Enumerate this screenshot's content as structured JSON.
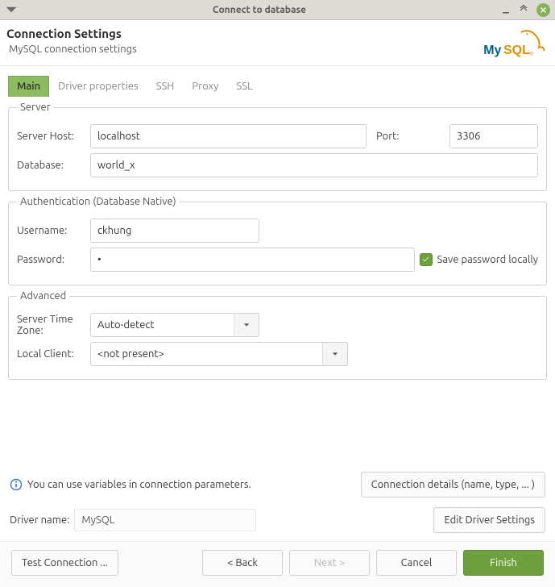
{
  "window": {
    "title": "Connect to database"
  },
  "header": {
    "title": "Connection Settings",
    "subtitle": "MySQL connection settings",
    "logo_text": "MySQL"
  },
  "tabs": [
    {
      "label": "Main",
      "active": true
    },
    {
      "label": "Driver properties",
      "active": false
    },
    {
      "label": "SSH",
      "active": false
    },
    {
      "label": "Proxy",
      "active": false
    },
    {
      "label": "SSL",
      "active": false
    }
  ],
  "server": {
    "legend": "Server",
    "host_label": "Server Host:",
    "host_value": "localhost",
    "port_label": "Port:",
    "port_value": "3306",
    "db_label": "Database:",
    "db_value": "world_x"
  },
  "auth": {
    "legend": "Authentication (Database Native)",
    "user_label": "Username:",
    "user_value": "ckhung",
    "pass_label": "Password:",
    "pass_value": "•",
    "save_label": "Save password locally",
    "save_checked": true
  },
  "advanced": {
    "legend": "Advanced",
    "tz_label": "Server Time Zone:",
    "tz_value": "Auto-detect",
    "client_label": "Local Client:",
    "client_value": "<not present>"
  },
  "info": {
    "text": "You can use variables in connection parameters.",
    "details_btn": "Connection details (name, type, ... )"
  },
  "driver": {
    "label": "Driver name:",
    "value": "MySQL",
    "edit_btn": "Edit Driver Settings"
  },
  "footer": {
    "test": "Test Connection ...",
    "back": "< Back",
    "next": "Next >",
    "cancel": "Cancel",
    "finish": "Finish"
  }
}
